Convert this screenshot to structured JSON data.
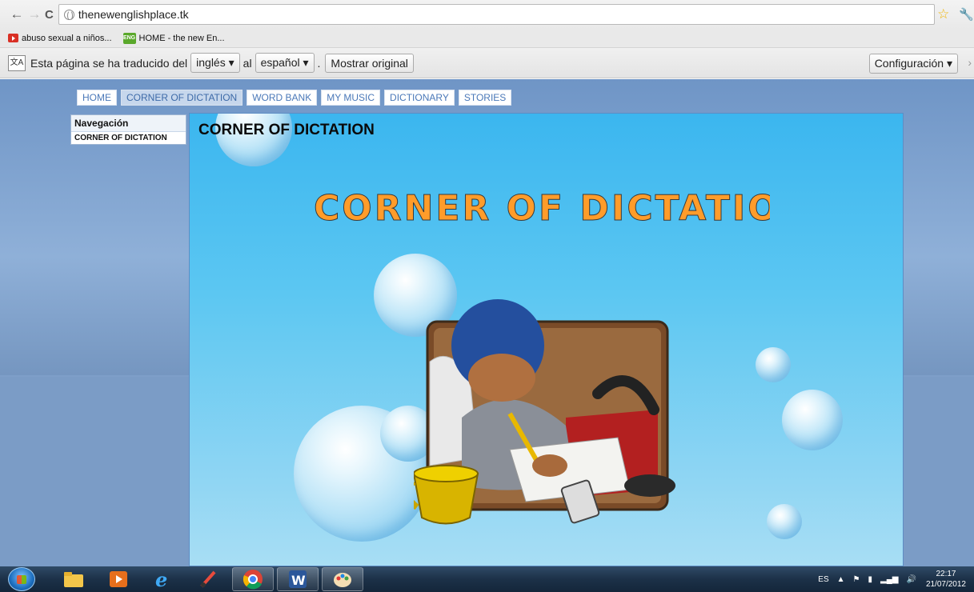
{
  "browser": {
    "url": "thenewenglishplace.tk",
    "bookmarks": [
      {
        "label": "abuso sexual a niños..."
      },
      {
        "label": "HOME - the new En..."
      }
    ]
  },
  "translate_bar": {
    "prefix": "Esta página se ha traducido del",
    "from_lang": "inglés",
    "connector": "al",
    "to_lang": "español",
    "dot": ".",
    "show_original": "Mostrar original",
    "settings": "Configuración"
  },
  "site": {
    "nav": [
      "HOME",
      "CORNER OF DICTATION",
      "WORD BANK",
      "MY MUSIC",
      "DICTIONARY",
      "STORIES"
    ],
    "active_nav": "CORNER OF DICTATION",
    "sidebar": {
      "heading": "Navegación",
      "item": "CORNER OF DICTATION"
    },
    "content": {
      "title": "CORNER OF DICTATION",
      "decorative_heading": "CORNER OF DICTATION"
    }
  },
  "taskbar": {
    "language": "ES",
    "time": "22:17",
    "date": "21/07/2012"
  }
}
